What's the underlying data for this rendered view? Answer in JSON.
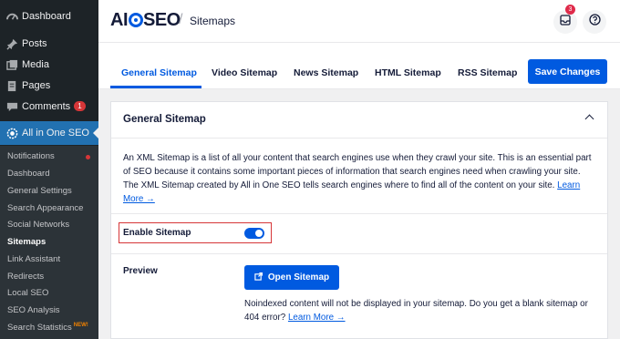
{
  "wp_menu": {
    "items": [
      {
        "label": "Dashboard",
        "icon": "dashboard-icon"
      },
      {
        "label": "Posts",
        "icon": "pin-icon"
      },
      {
        "label": "Media",
        "icon": "media-icon"
      },
      {
        "label": "Pages",
        "icon": "pages-icon"
      },
      {
        "label": "Comments",
        "icon": "comment-icon",
        "badge": "1"
      }
    ],
    "active": {
      "label": "All in One SEO",
      "icon": "aioseo-gear-icon"
    }
  },
  "submenu": {
    "items": [
      {
        "label": "Notifications",
        "dot": true
      },
      {
        "label": "Dashboard"
      },
      {
        "label": "General Settings"
      },
      {
        "label": "Search Appearance"
      },
      {
        "label": "Social Networks"
      },
      {
        "label": "Sitemaps",
        "current": true
      },
      {
        "label": "Link Assistant"
      },
      {
        "label": "Redirects"
      },
      {
        "label": "Local SEO"
      },
      {
        "label": "SEO Analysis"
      },
      {
        "label": "Search Statistics",
        "tag": "NEW!"
      }
    ]
  },
  "header": {
    "logo": "AIOSEO",
    "breadcrumb": "Sitemaps",
    "notifications_count": "3",
    "notif_icon": "inbox-icon",
    "help_icon": "help-icon"
  },
  "tabs": {
    "items": [
      "General Sitemap",
      "Video Sitemap",
      "News Sitemap",
      "HTML Sitemap",
      "RSS Sitemap"
    ],
    "active": "General Sitemap",
    "save_label": "Save Changes"
  },
  "card": {
    "title": "General Sitemap",
    "description": "An XML Sitemap is a list of all your content that search engines use when they crawl your site. This is an essential part of SEO because it contains some important pieces of information that search engines need when crawling your site. The XML Sitemap created by All in One SEO tells search engines where to find all of the content on your site.",
    "learn_more": "Learn More →",
    "enable_label": "Enable Sitemap",
    "enabled": true,
    "preview_label": "Preview",
    "open_button": "Open Sitemap",
    "preview_note": "Noindexed content will not be displayed in your sitemap. Do you get a blank sitemap or 404 error?",
    "preview_learn_more": "Learn More →"
  },
  "colors": {
    "accent": "#005ae0",
    "sidebar": "#1d2327",
    "active_menu": "#2271b1",
    "alert": "#d63638"
  }
}
